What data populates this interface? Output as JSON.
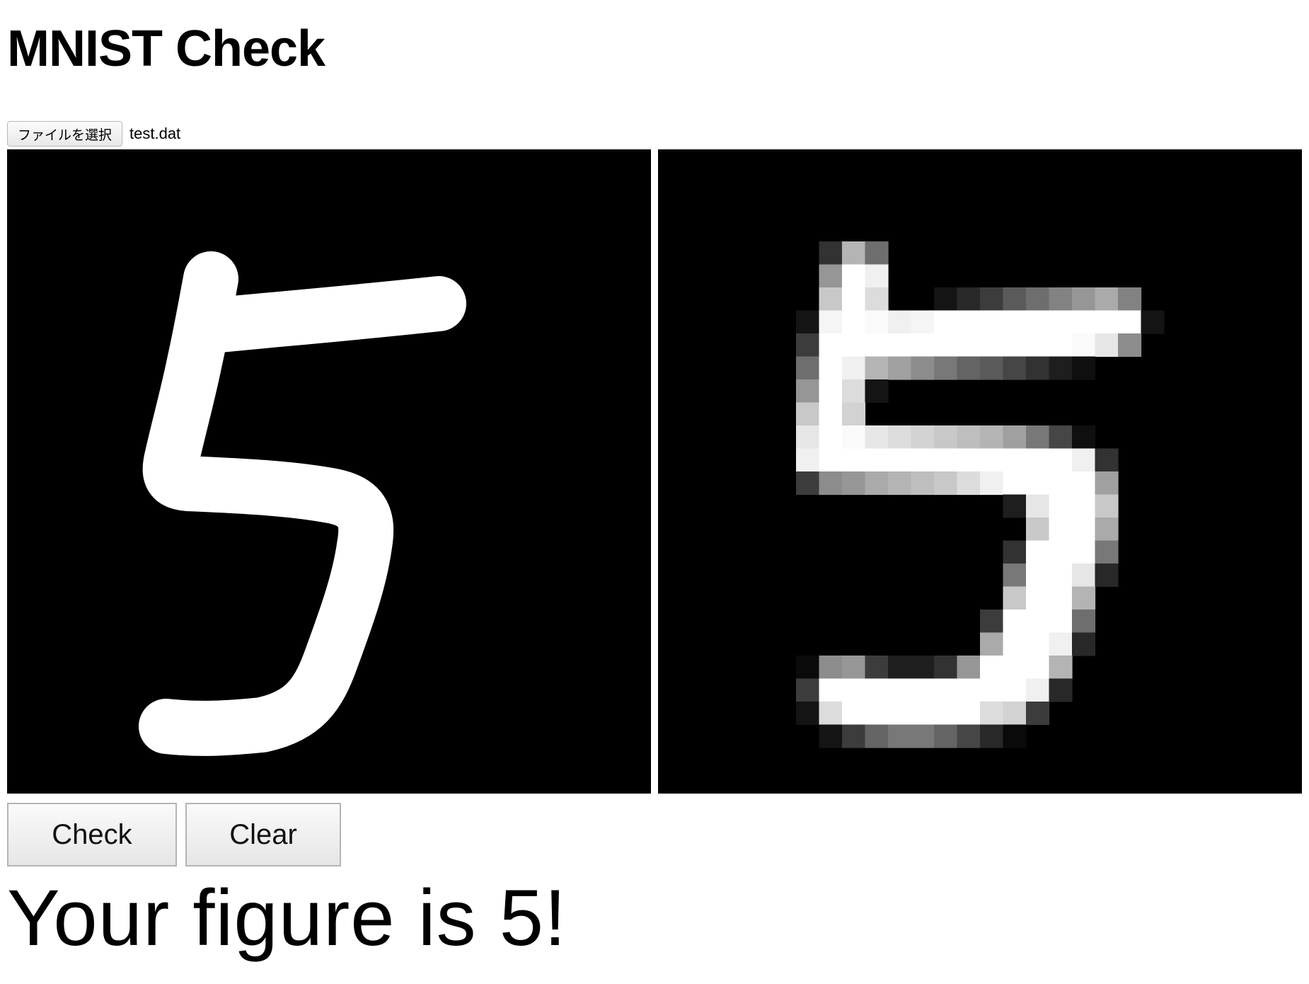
{
  "header": {
    "title": "MNIST Check"
  },
  "file_input": {
    "button_label": "ファイルを選択",
    "file_name": "test.dat"
  },
  "actions": {
    "check_label": "Check",
    "clear_label": "Clear"
  },
  "result": {
    "text": "Your figure is 5!"
  },
  "preview": {
    "grid_size": 28,
    "digit": "5"
  },
  "colors": {
    "canvas_background": "#000000",
    "stroke": "#ffffff"
  }
}
